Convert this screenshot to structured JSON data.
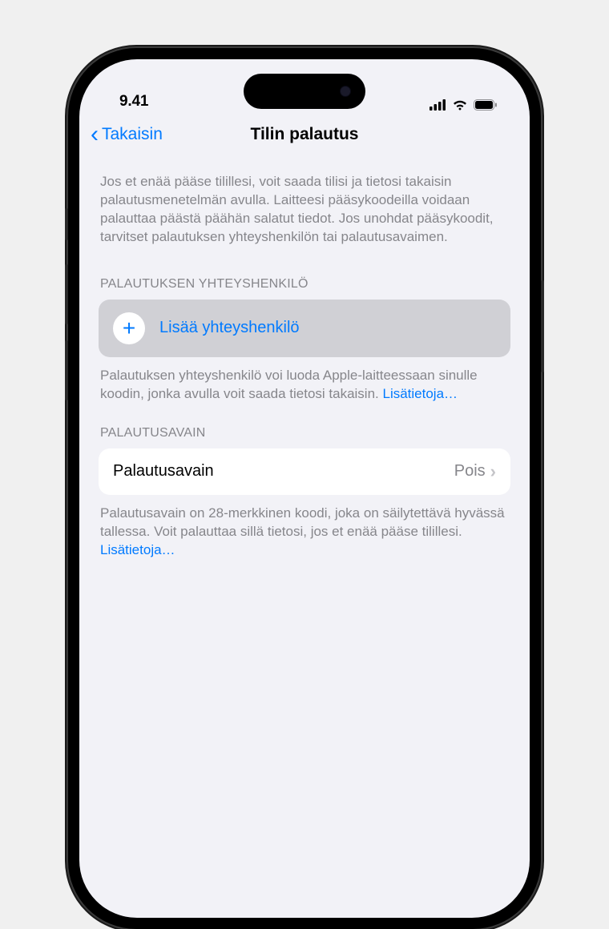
{
  "status": {
    "time": "9.41"
  },
  "nav": {
    "back": "Takaisin",
    "title": "Tilin palautus"
  },
  "intro": "Jos et enää pääse tilillesi, voit saada tilisi ja tietosi takaisin palautusmenetelmän avulla. Laitteesi pääsykoodeilla voidaan palauttaa päästä päähän salatut tiedot. Jos unohdat pääsykoodit, tarvitset palautuksen yhteyshenkilön tai palautusavaimen.",
  "contact": {
    "header": "PALAUTUKSEN YHTEYSHENKILÖ",
    "add_label": "Lisää yhteyshenkilö",
    "footer": "Palautuksen yhteyshenkilö voi luoda Apple-laitteessaan sinulle koodin, jonka avulla voit saada tietosi takaisin. ",
    "footer_link": "Lisätietoja…"
  },
  "recovery_key": {
    "header": "PALAUTUSAVAIN",
    "title": "Palautusavain",
    "value": "Pois",
    "footer": "Palautusavain on 28-merkkinen koodi, joka on säilytettävä hyvässä tallessa. Voit palauttaa sillä tietosi, jos et enää pääse tilillesi. ",
    "footer_link": "Lisätietoja…"
  }
}
